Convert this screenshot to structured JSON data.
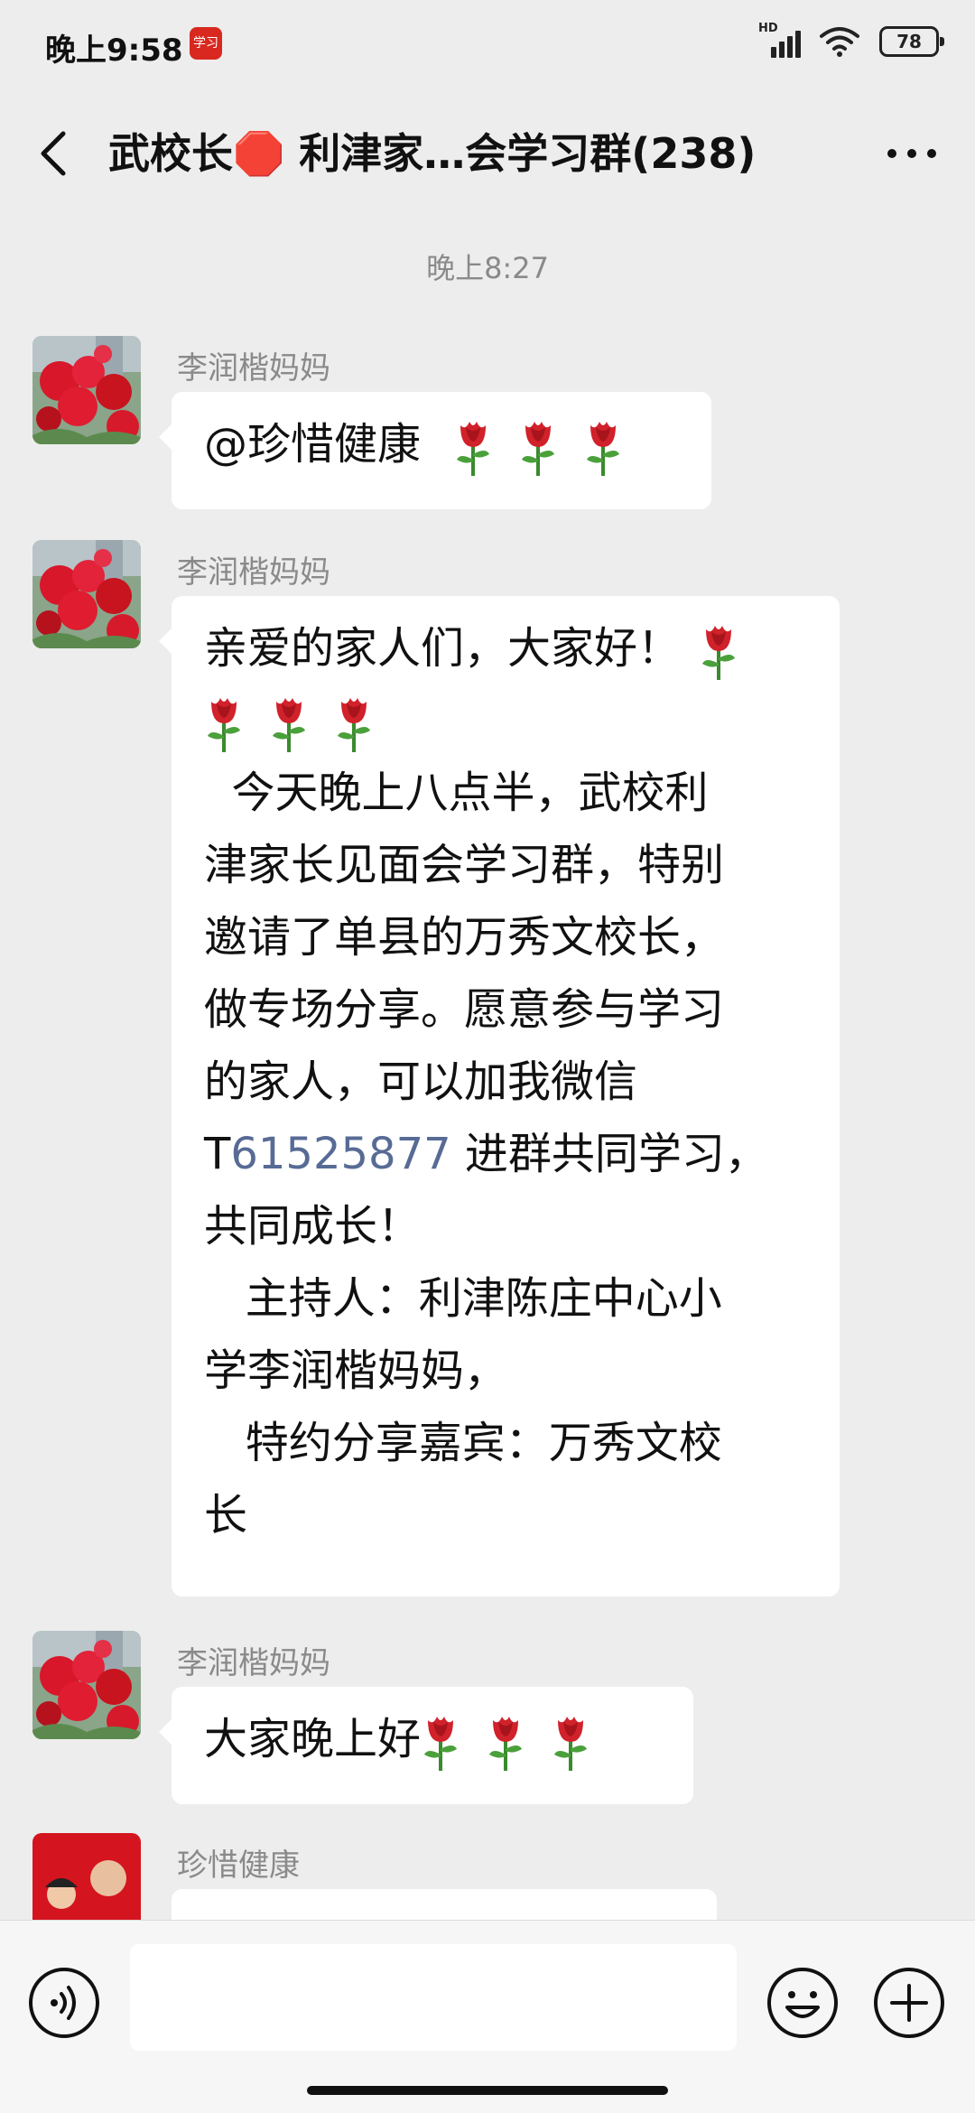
{
  "status_bar": {
    "time": "晚上9:58",
    "app_badge": "学习",
    "network": "HD",
    "battery": "78"
  },
  "header": {
    "title": "武校长🛑 利津家…会学习群(238)",
    "back_icon": "chevron-left-icon",
    "more_icon": "more-icon"
  },
  "chat": {
    "timestamp": "晚上8:27",
    "messages": [
      {
        "sender": "李润楷妈妈",
        "avatar": "red-flowers",
        "text": "@珍惜健康"
      },
      {
        "sender": "李润楷妈妈",
        "avatar": "red-flowers",
        "lines": [
          "亲爱的家人们，大家好！",
          "",
          "  今天晚上八点半，武校利",
          "津家长见面会学习群，特别",
          "邀请了单县的万秀文校长，",
          "做专场分享。愿意参与学习",
          "的家人，可以加我微信",
          "T",
          "61525877",
          " 进群共同学习，",
          "共同成长！",
          "   主持人：利津陈庄中心小",
          "学李润楷妈妈，",
          "   特约分享嘉宾：万秀文校",
          "长"
        ]
      },
      {
        "sender": "李润楷妈妈",
        "avatar": "red-flowers",
        "text": "大家晚上好"
      },
      {
        "sender": "珍惜健康",
        "avatar": "father-and-son"
      }
    ]
  },
  "input_bar": {
    "voice_icon": "voice-icon",
    "emoji_icon": "emoji-icon",
    "plus_icon": "plus-icon"
  }
}
